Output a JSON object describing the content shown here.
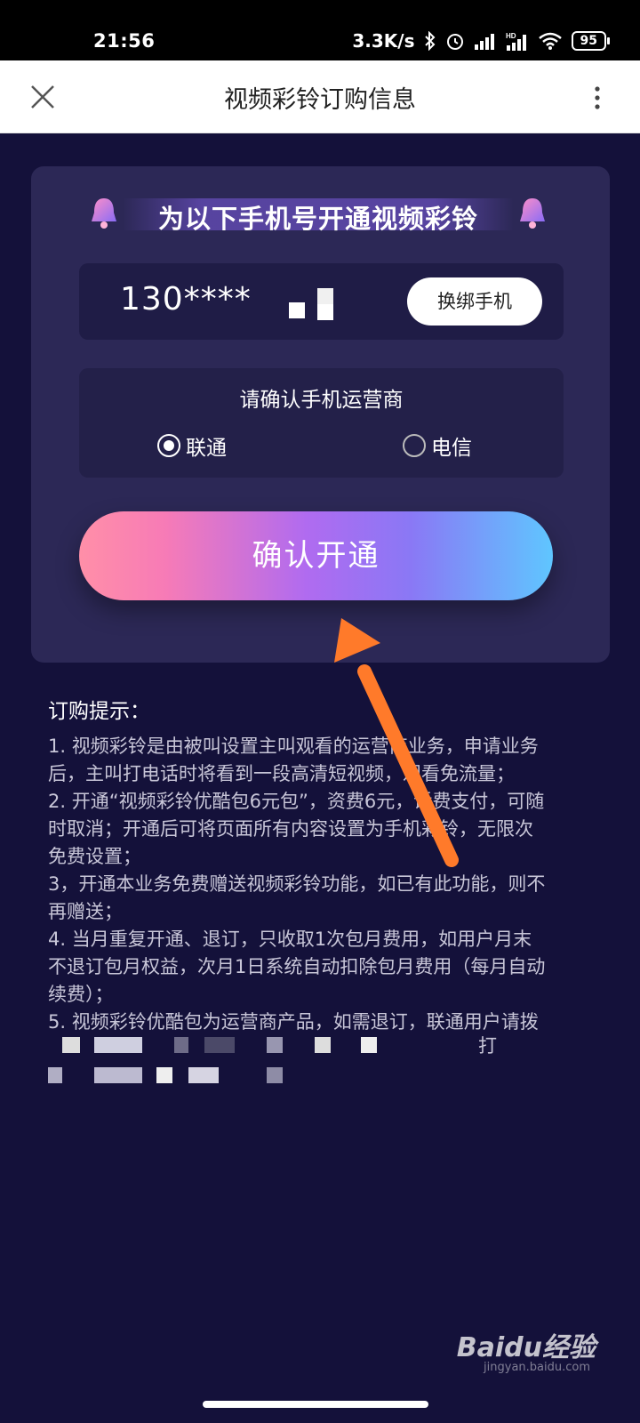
{
  "status_bar": {
    "time": "21:56",
    "speed": "3.3K/s",
    "battery": "95",
    "hd_label": "HD"
  },
  "app_bar": {
    "title": "视频彩铃订购信息",
    "close_icon": "close-icon",
    "more_icon": "more-vertical-icon"
  },
  "card": {
    "banner_text": "为以下手机号开通视频彩铃",
    "phone_number": "130****",
    "rebind_label": "换绑手机",
    "carrier_title": "请确认手机运营商",
    "carriers": [
      {
        "label": "联通",
        "selected": true
      },
      {
        "label": "电信",
        "selected": false
      }
    ],
    "confirm_label": "确认开通"
  },
  "tips": {
    "title": "订购提示：",
    "lines": [
      "1. 视频彩铃是由被叫设置主叫观看的运营商业务，申请业务",
      "后，主叫打电话时将看到一段高清短视频，观看免流量；",
      "2. 开通“视频彩铃优酷包6元包”，资费6元，话费支付，可随",
      "时取消；开通后可将页面所有内容设置为手机彩铃，无限次",
      "免费设置；",
      "3，开通本业务免费赠送视频彩铃功能，如已有此功能，则不",
      "再赠送；",
      "4. 当月重复开通、退订，只收取1次包月费用，如用户月末",
      "不退订包月权益，次月1日系统自动扣除包月费用（每月自动",
      "续费）；",
      "5. 视频彩铃优酷包为运营商产品，如需退订，联通用户请拨"
    ],
    "line_partial": "打"
  },
  "watermark": {
    "brand": "Baidu经验",
    "url": "jingyan.baidu.com"
  },
  "colors": {
    "background": "#14113a",
    "card": "#2c2856",
    "arrow": "#ff7a2a"
  }
}
